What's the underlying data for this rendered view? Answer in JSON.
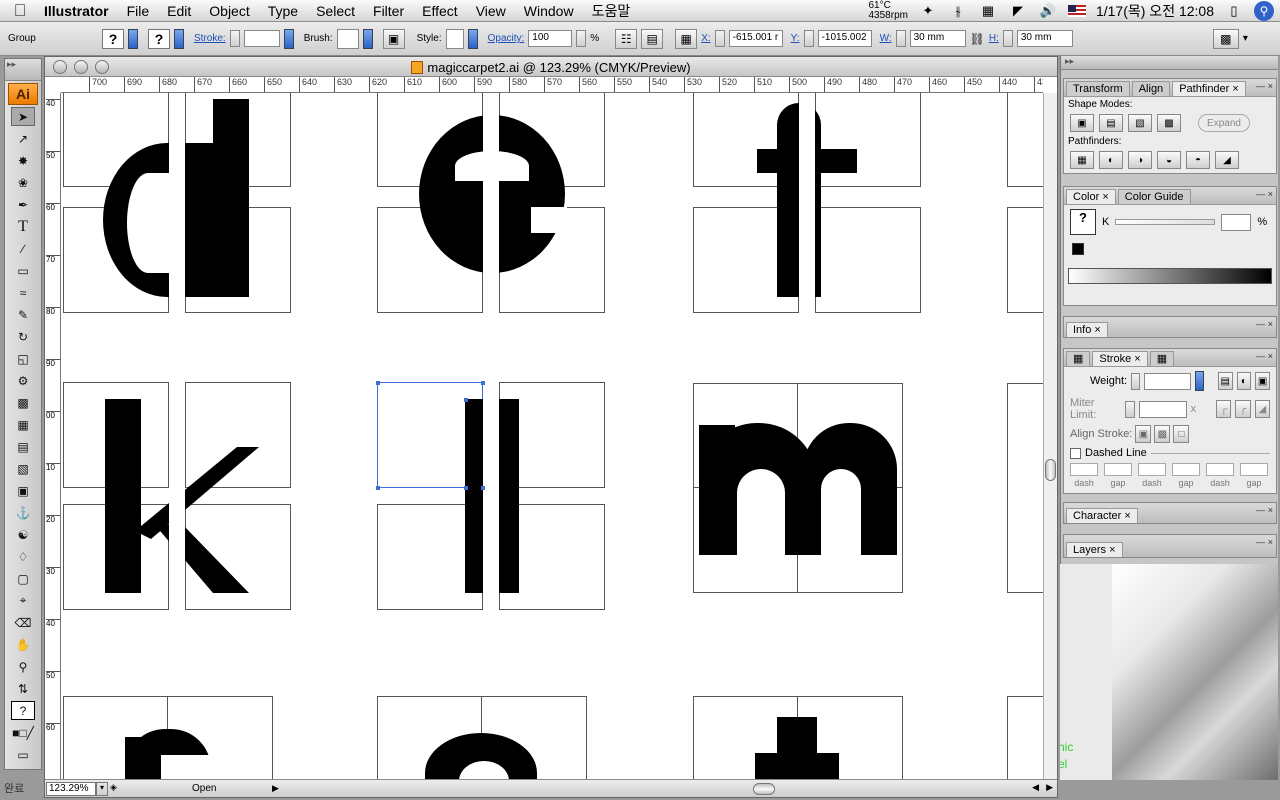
{
  "menubar": {
    "app_name": "Illustrator",
    "items": [
      "File",
      "Edit",
      "Object",
      "Type",
      "Select",
      "Filter",
      "Effect",
      "View",
      "Window",
      "도움말"
    ],
    "temp_line1": "61°C",
    "temp_line2": "4358rpm",
    "datetime": "1/17(목) 오전 12:08"
  },
  "control_bar": {
    "selection_label": "Group",
    "stroke_label": "Stroke:",
    "brush_label": "Brush:",
    "style_label": "Style:",
    "opacity_label": "Opacity:",
    "opacity_value": "100",
    "opacity_unit": "%",
    "x_label": "X:",
    "x_value": "-615.001 r",
    "y_label": "Y:",
    "y_value": "-1015.002",
    "w_label": "W:",
    "w_value": "30 mm",
    "h_label": "H:",
    "h_value": "30 mm",
    "q_mark": "?"
  },
  "toolbox": {
    "logo": "Ai"
  },
  "document": {
    "title": "magiccarpet2.ai @ 123.29% (CMYK/Preview)",
    "zoom": "123.29%",
    "status": "Open",
    "ruler_h": [
      "700",
      "690",
      "680",
      "670",
      "660",
      "650",
      "640",
      "630",
      "620",
      "610",
      "600",
      "590",
      "580",
      "570",
      "560",
      "550",
      "540",
      "530",
      "520",
      "510",
      "500",
      "490",
      "480",
      "470",
      "460",
      "450",
      "440",
      "430"
    ],
    "ruler_v": [
      "40",
      "50",
      "60",
      "70",
      "80",
      "90",
      "00",
      "10",
      "20",
      "30",
      "40",
      "50",
      "60"
    ]
  },
  "panels": {
    "pathfinder": {
      "tabs": [
        "Transform",
        "Align",
        "Pathfinder"
      ],
      "shape_modes_label": "Shape Modes:",
      "pathfinders_label": "Pathfinders:",
      "expand_label": "Expand"
    },
    "color": {
      "tabs": [
        "Color",
        "Color Guide"
      ],
      "channel": "K",
      "percent": "%"
    },
    "info": {
      "tab": "Info"
    },
    "stroke": {
      "tab": "Stroke",
      "weight_label": "Weight:",
      "miter_label": "Miter Limit:",
      "miter_x": "x",
      "align_label": "Align Stroke:",
      "dashed_label": "Dashed Line",
      "dash_labels": [
        "dash",
        "gap",
        "dash",
        "gap",
        "dash",
        "gap"
      ]
    },
    "character": {
      "tab": "Character"
    },
    "layers": {
      "tab": "Layers"
    }
  },
  "desktop": {
    "text1": "hic",
    "text2": "el",
    "bottom_left": "완료"
  }
}
